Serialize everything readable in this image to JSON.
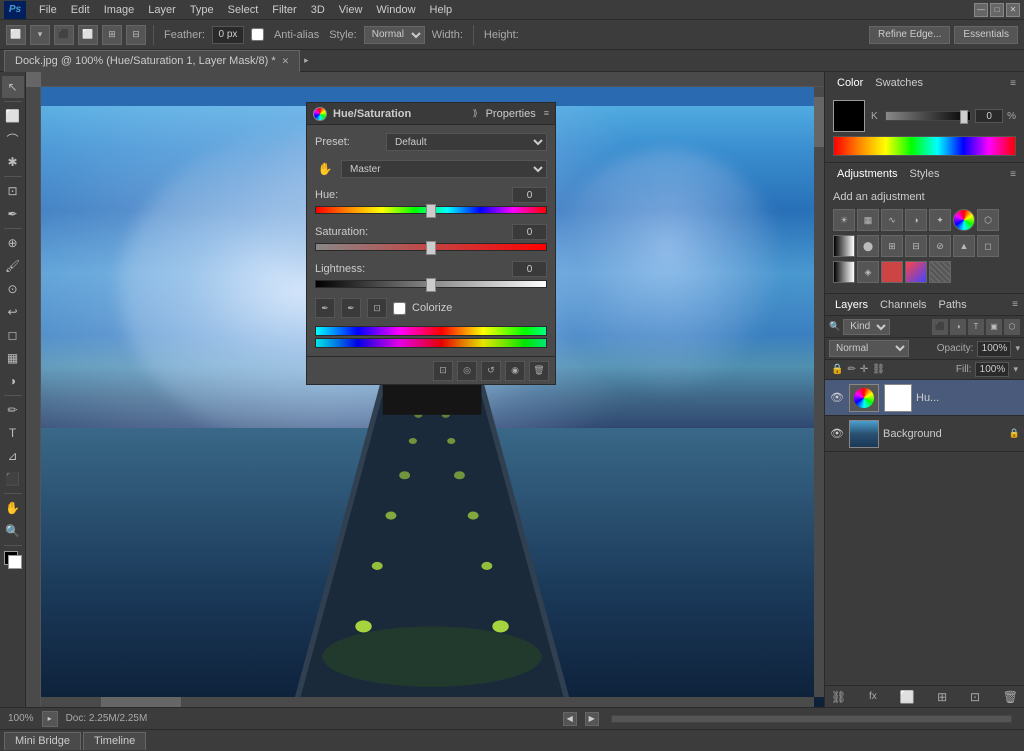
{
  "app": {
    "title": "Adobe Photoshop",
    "logo": "Ps"
  },
  "menu": {
    "items": [
      "File",
      "Edit",
      "Image",
      "Layer",
      "Type",
      "Select",
      "Filter",
      "3D",
      "View",
      "Window",
      "Help"
    ]
  },
  "window_controls": {
    "minimize": "—",
    "maximize": "□",
    "close": "✕"
  },
  "toolbar": {
    "feather_label": "Feather:",
    "feather_value": "0 px",
    "antialias_label": "Anti-alias",
    "style_label": "Style:",
    "style_value": "Normal",
    "width_label": "Width:",
    "height_label": "Height:",
    "refine_edge": "Refine Edge...",
    "essentials": "Essentials"
  },
  "tab": {
    "title": "Dock.jpg @ 100% (Hue/Saturation 1, Layer Mask/8) *",
    "close": "✕"
  },
  "properties_panel": {
    "title": "Properties",
    "hue_sat_title": "Hue/Saturation",
    "preset_label": "Preset:",
    "preset_value": "Default",
    "channel_value": "Master",
    "hue_label": "Hue:",
    "hue_value": "0",
    "saturation_label": "Saturation:",
    "saturation_value": "0",
    "lightness_label": "Lightness:",
    "lightness_value": "0",
    "colorize_label": "Colorize"
  },
  "color_panel": {
    "tab1": "Color",
    "tab2": "Swatches",
    "k_label": "K",
    "k_value": "0",
    "k_percent": "%"
  },
  "adjustments_panel": {
    "tab1": "Adjustments",
    "tab2": "Styles",
    "add_label": "Add an adjustment",
    "icons": [
      "brightness",
      "levels",
      "curves",
      "exposure",
      "vibrance",
      "hue-sat",
      "color-balance",
      "black-white",
      "photo-filter",
      "channel-mixer",
      "selective-color",
      "invert",
      "posterize",
      "threshold",
      "gradient-map",
      "selective",
      "solid-color",
      "gradient-fill",
      "pattern"
    ]
  },
  "layers_panel": {
    "tab1": "Layers",
    "tab2": "Channels",
    "tab3": "Paths",
    "filter_label": "Kind",
    "blend_mode": "Normal",
    "opacity_label": "Opacity:",
    "opacity_value": "100%",
    "fill_label": "Fill:",
    "fill_value": "100%",
    "lock_icons": [
      "🔒",
      "✏",
      "⬛",
      "⛓"
    ],
    "layers": [
      {
        "name": "Hu...",
        "type": "hue-sat",
        "visible": true,
        "has_mask": true,
        "mask_color": "#ffffff"
      },
      {
        "name": "Background",
        "type": "image",
        "visible": true,
        "locked": true
      }
    ],
    "footer_icons": [
      "link",
      "fx",
      "mask",
      "group",
      "new",
      "trash"
    ]
  },
  "status_bar": {
    "zoom": "100%",
    "doc_info": "Doc: 2.25M/2.25M"
  },
  "bottom_tabs": [
    "Mini Bridge",
    "Timeline"
  ]
}
